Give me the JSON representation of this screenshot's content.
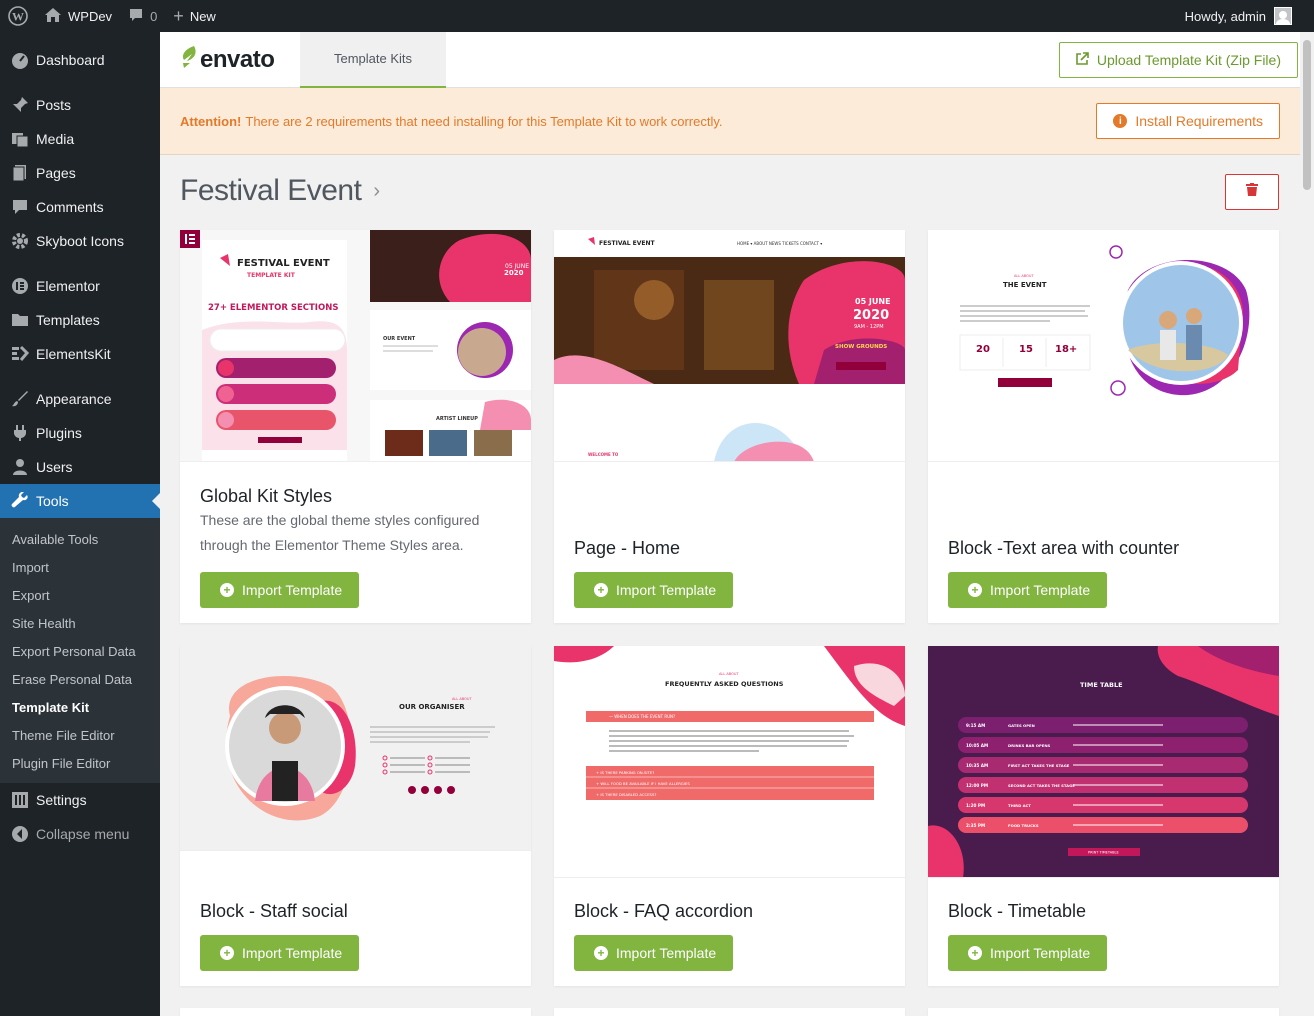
{
  "adminbar": {
    "site_name": "WPDev",
    "comments_count": "0",
    "new_label": "New",
    "greeting": "Howdy, admin"
  },
  "sidebar": {
    "items": [
      {
        "label": "Dashboard",
        "icon": "dashboard-icon"
      },
      {
        "label": "Posts",
        "icon": "pin-icon"
      },
      {
        "label": "Media",
        "icon": "media-icon"
      },
      {
        "label": "Pages",
        "icon": "pages-icon"
      },
      {
        "label": "Comments",
        "icon": "comments-icon"
      },
      {
        "label": "Skyboot Icons",
        "icon": "gear-icon"
      },
      {
        "label": "Elementor",
        "icon": "elementor-icon"
      },
      {
        "label": "Templates",
        "icon": "folder-icon"
      },
      {
        "label": "ElementsKit",
        "icon": "elementskit-icon"
      },
      {
        "label": "Appearance",
        "icon": "brush-icon"
      },
      {
        "label": "Plugins",
        "icon": "plug-icon"
      },
      {
        "label": "Users",
        "icon": "user-icon"
      },
      {
        "label": "Tools",
        "icon": "wrench-icon"
      }
    ],
    "tools_submenu": [
      "Available Tools",
      "Import",
      "Export",
      "Site Health",
      "Export Personal Data",
      "Erase Personal Data",
      "Template Kit",
      "Theme File Editor",
      "Plugin File Editor"
    ],
    "settings_label": "Settings",
    "collapse_label": "Collapse menu"
  },
  "topbar": {
    "logo": "envato",
    "tab_label": "Template Kits",
    "upload_label": "Upload Template Kit (Zip File)"
  },
  "notice": {
    "strong": "Attention!",
    "text": "There are 2 requirements that need installing for this Template Kit to work correctly.",
    "install_label": "Install Requirements"
  },
  "kit": {
    "title": "Festival Event"
  },
  "cards": [
    {
      "title": "Global Kit Styles",
      "desc": "These are the global theme styles configured through the Elementor Theme Styles area.",
      "button": "Import Template"
    },
    {
      "title": "Page - Home",
      "desc": "",
      "button": "Import Template"
    },
    {
      "title": "Block -Text area with counter",
      "desc": "",
      "button": "Import Template"
    },
    {
      "title": "Block - Staff social",
      "desc": "",
      "button": "Import Template"
    },
    {
      "title": "Block - FAQ accordion",
      "desc": "",
      "button": "Import Template"
    },
    {
      "title": "Block - Timetable",
      "desc": "",
      "button": "Import Template"
    }
  ],
  "thumb_text": {
    "global_heading": "FESTIVAL EVENT",
    "global_sub": "TEMPLATE KIT",
    "global_sections": "27+ ELEMENTOR SECTIONS",
    "home_brand": "FESTIVAL EVENT",
    "home_date": "05 JUNE",
    "home_year": "2020",
    "home_time": "9AM - 12PM",
    "home_venue": "SHOW GROUNDS",
    "counter_title": "THE EVENT",
    "counter_values": [
      "20",
      "15",
      "18+"
    ],
    "staff_title": "OUR ORGANISER",
    "faq_title": "FREQUENTLY ASKED QUESTIONS",
    "timetable_title": "TIME TABLE",
    "timetable_times": [
      "9:15 AM",
      "10:05 AM",
      "10:35 AM",
      "12:00 PM",
      "1:20 PM",
      "2:35 PM"
    ],
    "timetable_events": [
      "GATES OPEN",
      "DRINKS BAR OPENS",
      "FIRST ACT TAKES THE STAGE",
      "SECOND ACT TAKES THE STAGE",
      "THIRD ACT",
      "FOOD TRUCKS"
    ]
  },
  "colors": {
    "accent_green": "#82b440",
    "wp_blue": "#2271b1",
    "notice_orange": "#e37a2a",
    "danger_red": "#d63638",
    "festival_pink": "#e8346a",
    "festival_purple": "#4a1b4d"
  }
}
